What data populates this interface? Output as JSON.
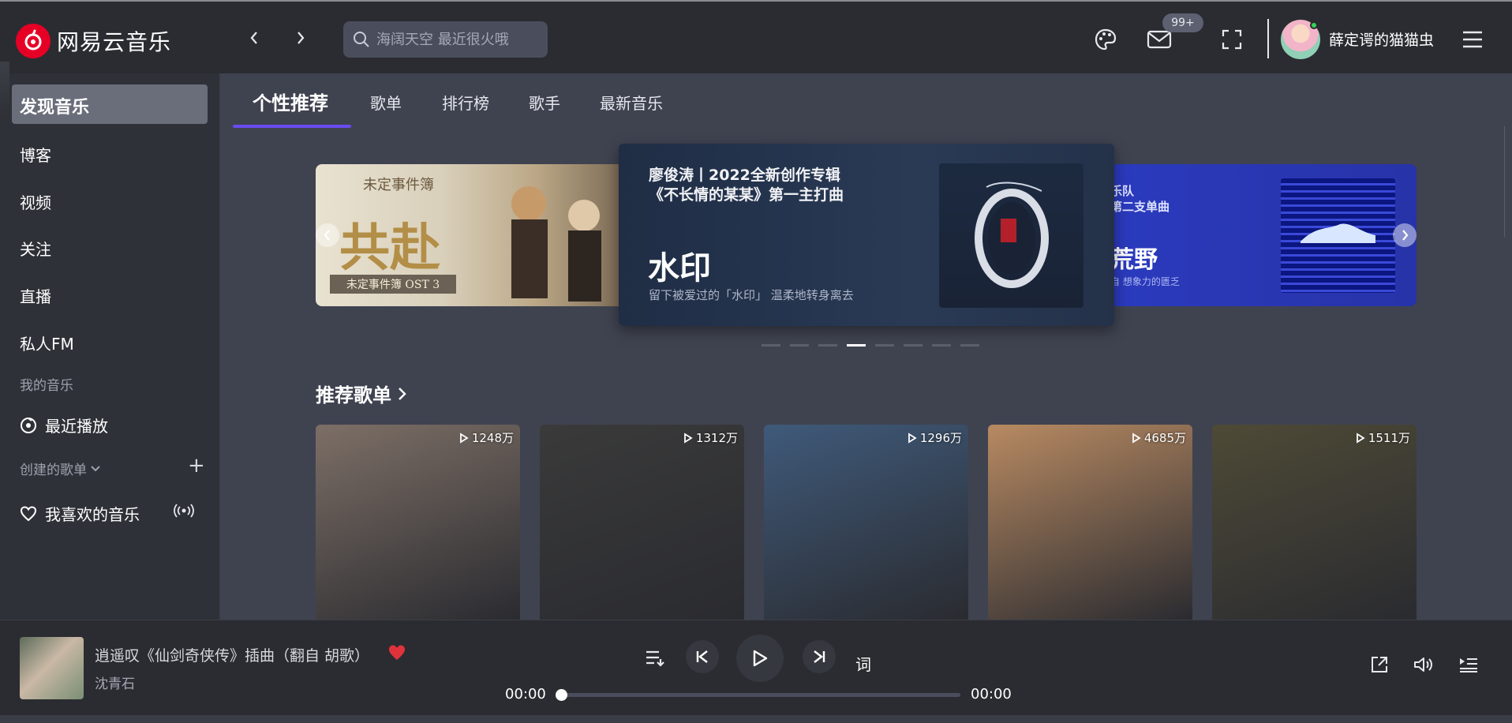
{
  "app": {
    "name": "网易云音乐",
    "search_placeholder": "海阔天空 最近很火哦",
    "message_badge": "99+",
    "username": "薛定谔的猫猫虫"
  },
  "sidebar": {
    "active": "发现音乐",
    "items": [
      "博客",
      "视频",
      "关注",
      "直播",
      "私人FM"
    ],
    "my_music_label": "我的音乐",
    "recent_label": "最近播放",
    "created_label": "创建的歌单",
    "liked_label": "我喜欢的音乐"
  },
  "tabs": [
    "个性推荐",
    "歌单",
    "排行榜",
    "歌手",
    "最新音乐"
  ],
  "banner": {
    "left": {
      "top_text": "未定事件簿",
      "title": "共赴",
      "ost": "未定事件簿 OST 3"
    },
    "center": {
      "subtitle": "廖俊涛丨2022全新创作专辑\n《不长情的某某》第一主打曲",
      "title": "水印",
      "tagline": "留下被爱过的「水印」 温柔地转身离去"
    },
    "right": {
      "sub1": "乐队",
      "sub2": "第二支单曲",
      "title": "荒野",
      "tagline": "自 想象力的匮乏"
    },
    "dots_total": 8,
    "active_dot": 4
  },
  "recommend": {
    "title": "推荐歌单",
    "cards": [
      {
        "count": "1248万",
        "color": "#7d6f66"
      },
      {
        "count": "1312万",
        "color": "#3a3a3a"
      },
      {
        "count": "1296万",
        "color": "#3f5a7a"
      },
      {
        "count": "4685万",
        "color": "#b88a62"
      },
      {
        "count": "1511万",
        "color": "#4e4a36"
      }
    ]
  },
  "player": {
    "title": "逍遥叹《仙剑奇侠传》插曲（翻自 胡歌）",
    "artist": "沈青石",
    "current_time": "00:00",
    "total_time": "00:00",
    "lyric_label": "词"
  },
  "colors": {
    "accent_tab": "#6a4cf0",
    "brand_red": "#e60026",
    "heart": "#e0323a"
  }
}
